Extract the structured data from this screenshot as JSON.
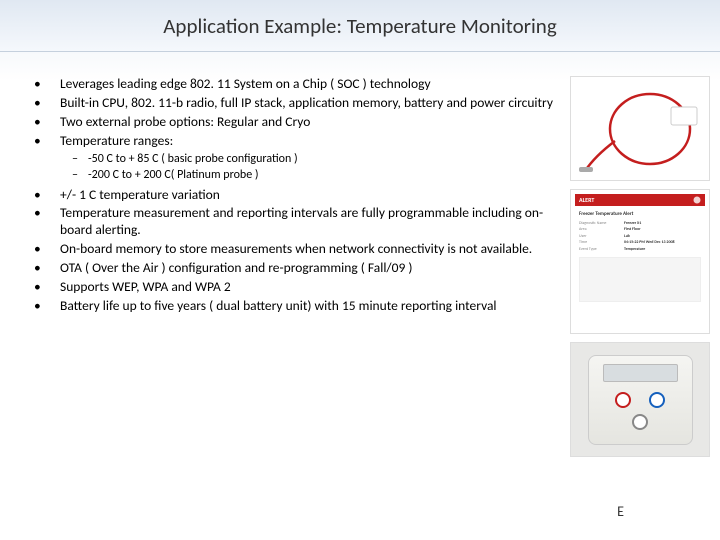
{
  "title": "Application Example: Temperature Monitoring",
  "bullets": {
    "b1": "Leverages leading edge 802. 11 System on a Chip ( SOC ) technology",
    "b2": "Built-in CPU, 802. 11-b radio, full IP stack, application memory, battery and power circuitry",
    "b3": "Two external probe options: Regular and Cryo",
    "b4": "Temperature ranges:",
    "s1": "-50 C to + 85 C ( basic probe configuration )",
    "s2": "-200 C to + 200 C( Platinum probe )",
    "b5": "+/- 1 C temperature variation",
    "b6": "Temperature measurement and reporting intervals are fully programmable including on-board alerting.",
    "b7": "On-board memory to store measurements when network connectivity is not available.",
    "b8": "OTA ( Over the Air )  configuration and re-programming ( Fall/09 )",
    "b9": "Supports WEP, WPA and WPA 2",
    "b10": "Battery life up to five years ( dual battery unit) with 15 minute reporting interval"
  },
  "alert": {
    "bar": "ALERT",
    "title": "Freezer Temperature Alert",
    "rows": {
      "r1l": "Diagnostic Name",
      "r1v": "Freezer X1",
      "r2l": "Area",
      "r2v": "First Floor",
      "r3l": "User",
      "r3v": "Lab",
      "r4l": "Time",
      "r4v": "04:15:22 PM  Wed Dec 13 2008",
      "r5l": "Event Type",
      "r5v": "Temperature"
    }
  },
  "corner": "E"
}
